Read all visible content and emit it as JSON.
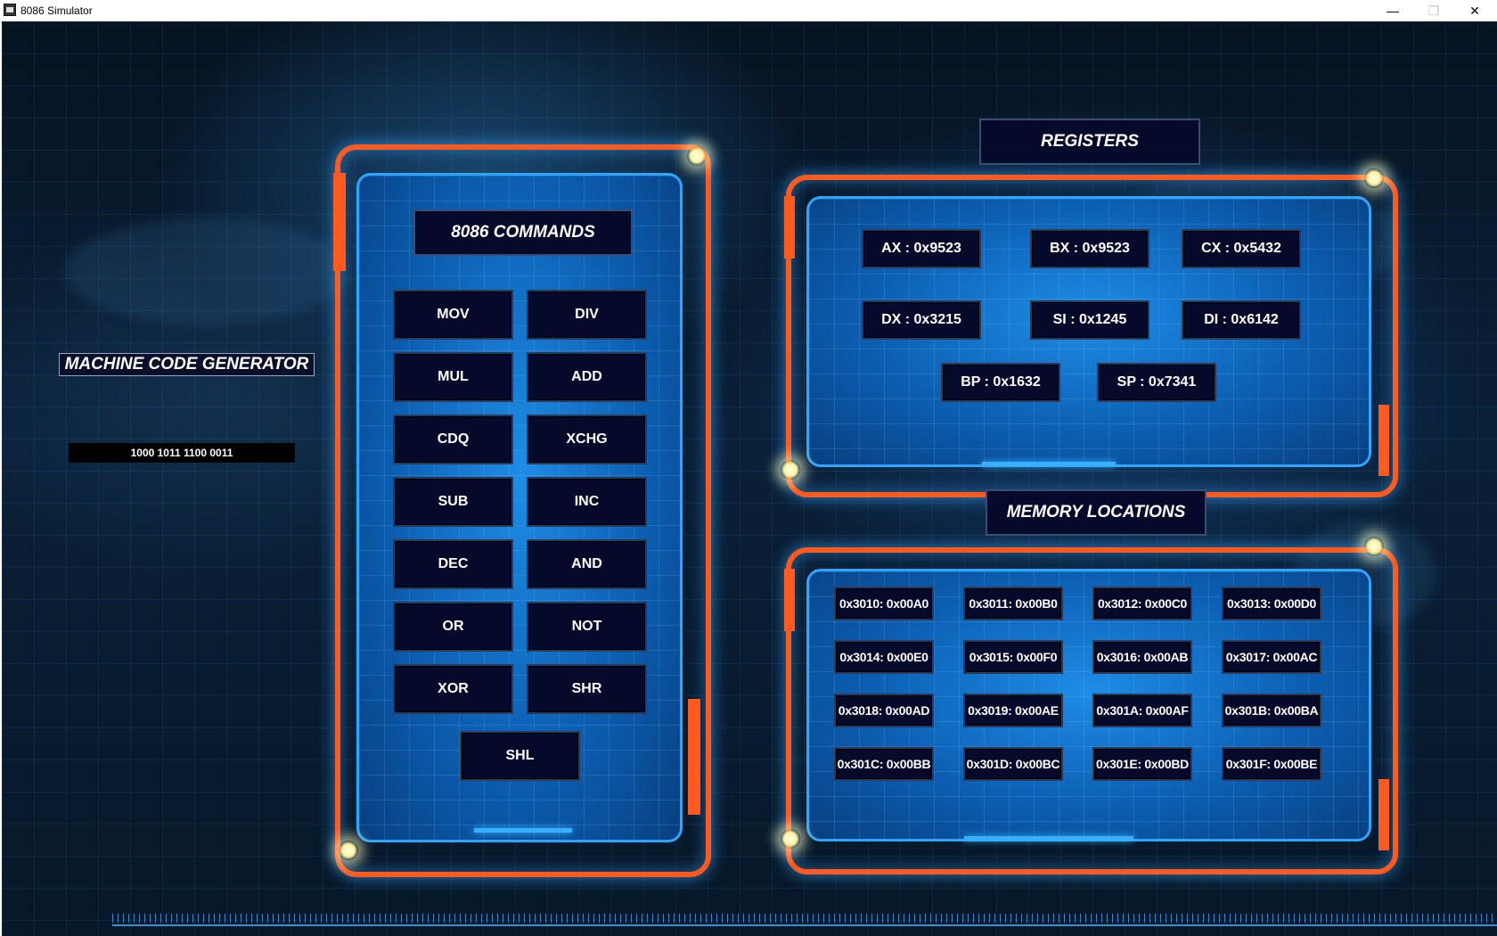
{
  "window": {
    "title": "8086 Simulator",
    "minimize_icon": "—",
    "maximize_icon": "❐",
    "close_icon": "✕"
  },
  "generator": {
    "title": "MACHINE CODE GENERATOR",
    "output": "1000 1011 1100 0011"
  },
  "commands": {
    "title": "8086 COMMANDS",
    "buttons": [
      "MOV",
      "DIV",
      "MUL",
      "ADD",
      "CDQ",
      "XCHG",
      "SUB",
      "INC",
      "DEC",
      "AND",
      "OR",
      "NOT",
      "XOR",
      "SHR",
      "SHL"
    ]
  },
  "registers": {
    "title": "REGISTERS",
    "items": [
      "AX : 0x9523",
      "BX : 0x9523",
      "CX : 0x5432",
      "DX : 0x3215",
      "SI : 0x1245",
      "DI : 0x6142",
      "BP : 0x1632",
      "SP : 0x7341"
    ]
  },
  "memory": {
    "title": "MEMORY LOCATIONS",
    "items": [
      "0x3010: 0x00A0",
      "0x3011: 0x00B0",
      "0x3012: 0x00C0",
      "0x3013: 0x00D0",
      "0x3014: 0x00E0",
      "0x3015: 0x00F0",
      "0x3016: 0x00AB",
      "0x3017: 0x00AC",
      "0x3018: 0x00AD",
      "0x3019: 0x00AE",
      "0x301A: 0x00AF",
      "0x301B: 0x00BA",
      "0x301C: 0x00BB",
      "0x301D: 0x00BC",
      "0x301E: 0x00BD",
      "0x301F: 0x00BE"
    ]
  },
  "colors": {
    "frame_orange": "#ff5a1f",
    "frame_blue": "#2ea6ff",
    "button_bg": "#050a2a"
  }
}
